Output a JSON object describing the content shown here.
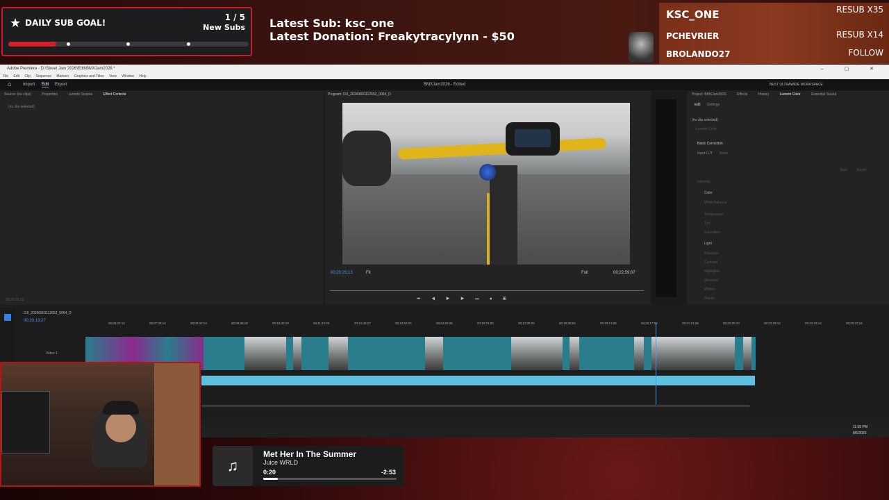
{
  "sub_goal": {
    "title": "DAILY SUB GOAL!",
    "count": "1 / 5",
    "label": "New Subs",
    "progress": 0.2
  },
  "latest": {
    "sub": "Latest Sub: ksc_one",
    "donation": "Latest Donation: Freakytracylynn  - $50"
  },
  "leaderboard": [
    {
      "name": "KSC_ONE",
      "status": "RESUB X35"
    },
    {
      "name": "PCHEVRIER",
      "status": "RESUB X14"
    },
    {
      "name": "BROLANDO27",
      "status": "FOLLOW"
    }
  ],
  "premiere": {
    "window_title": "Adobe Premiere - D:\\Street Jam 2026\\Edit\\BMXJam2026 *",
    "menu": [
      "File",
      "Edit",
      "Clip",
      "Sequence",
      "Markers",
      "Graphics and Titles",
      "View",
      "Window",
      "Help"
    ],
    "app_tabs": [
      "Import",
      "Edit",
      "Export"
    ],
    "project_title": "BMXJam2026 - Edited",
    "workspace": "BEST ULTRAWIDE WORKSPACE",
    "left_tabs": [
      "Source: (no clips)",
      "Properties",
      "Lumetri Scopes",
      "Effect Controls"
    ],
    "no_clip": "(no clip selected)",
    "left_timecode": "00;20;25;13",
    "program_title": "Program: DJI_20260801112652_0064_D",
    "program_tc_in": "00;20;25;13",
    "fit": "Fit",
    "full": "Full",
    "program_tc_out": "00;22;59;07",
    "right_tabs": [
      "Project: BMXJam2026",
      "Effects",
      "History",
      "Lumetri Color",
      "Essential Sound"
    ],
    "lumetri_subtabs": [
      "Edit",
      "Settings"
    ],
    "lumetri_no_clip": "(no clip selected)",
    "lumetri_preset": "Lumetri Color",
    "basic_correction": "Basic Correction",
    "input_lut": "Input LUT",
    "input_lut_value": "None",
    "auto": "Auto",
    "reset": "Reset",
    "intensity": "Intensity",
    "color_section": "Color",
    "white_balance": "White Balance",
    "color_sliders": [
      "Temperature",
      "Tint",
      "Saturation"
    ],
    "light_section": "Light",
    "light_sliders": [
      "Exposure",
      "Contrast",
      "Highlights",
      "Shadows",
      "Whites",
      "Blacks"
    ],
    "meter_ticks": [
      "0",
      "-6",
      "-12",
      "-18",
      "-24",
      "-30",
      "-36",
      "-42",
      "-48",
      "-54"
    ],
    "sequence_name": "DJI_20260801112652_0064_D",
    "timeline_tc": "00;20;13;27",
    "track_v1": "Video 1",
    "ruler": [
      "00;06;24;12",
      "00;07;28;14",
      "00;08;32;14",
      "00;09;36;18",
      "00;10;40;18",
      "00;11;44;20",
      "00;12;48;22",
      "00;13;52;24",
      "00;14;56;26",
      "00;16;01;00",
      "00;17;05;02",
      "00;18;09;04",
      "00;19;13;06",
      "00;20;17;06",
      "00;21;21;08",
      "00;22;25;10",
      "00;23;29;12",
      "00;24;33;14",
      "00;25;37;16"
    ]
  },
  "taskbar": {
    "time": "11:05 PM",
    "date": "8/5/2026"
  },
  "music": {
    "song": "Met Her In The Summer",
    "artist": "Juice WRLD",
    "current": "0:20",
    "remaining": "-2:53",
    "progress": 0.11
  }
}
